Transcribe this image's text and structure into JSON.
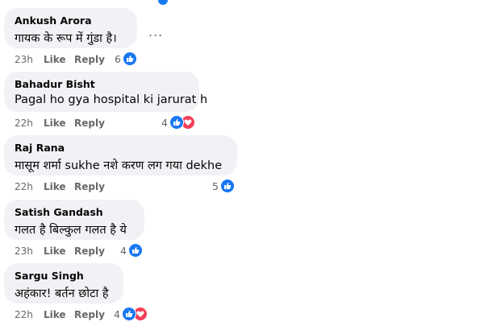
{
  "comments": [
    {
      "author": "Ankush Arora",
      "text": "गायक के रूप में गुंडा है।",
      "time": "23h",
      "like": "Like",
      "reply": "Reply",
      "reactions": "6",
      "reaction_types": [
        "like"
      ],
      "more": "..."
    },
    {
      "author": "Bahadur Bisht",
      "text": "Pagal ho gya hospital ki jarurat h",
      "time": "22h",
      "like": "Like",
      "reply": "Reply",
      "reactions": "4",
      "reaction_types": [
        "like",
        "love"
      ]
    },
    {
      "author": "Raj Rana",
      "text": "मासूम शर्मा sukhe नशे करण लग गया dekhe",
      "time": "22h",
      "like": "Like",
      "reply": "Reply",
      "reactions": "5",
      "reaction_types": [
        "like"
      ]
    },
    {
      "author": "Satish Gandash",
      "text": "गलत है बिल्कुल गलत है ये",
      "time": "23h",
      "like": "Like",
      "reply": "Reply",
      "reactions": "4",
      "reaction_types": [
        "like"
      ]
    },
    {
      "author": "Sargu Singh",
      "text": "अहंकार! बर्तन छोटा है",
      "time": "22h",
      "like": "Like",
      "reply": "Reply",
      "reactions": "4",
      "reaction_types": [
        "like",
        "love"
      ]
    }
  ],
  "colors": {
    "bubble": "#f0f2f5",
    "like_blue": "#1877f2",
    "love_red": "#f33e58",
    "meta_gray": "#65676b"
  }
}
